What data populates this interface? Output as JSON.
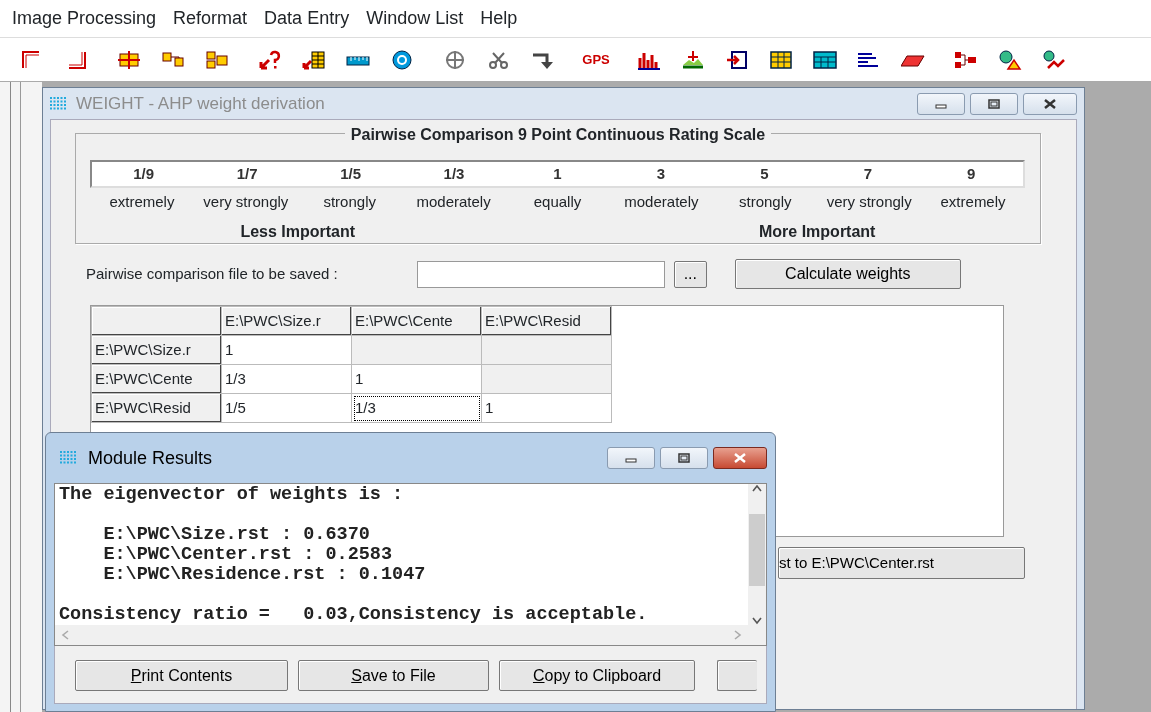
{
  "menu": [
    {
      "label": "Image Processing"
    },
    {
      "label": "Reformat"
    },
    {
      "label": "Data Entry"
    },
    {
      "label": "Window List"
    },
    {
      "label": "Help"
    }
  ],
  "toolbar": {
    "gps_label": "GPS"
  },
  "weight_window": {
    "title": "WEIGHT - AHP weight derivation",
    "active": false,
    "scale": {
      "title": "Pairwise Comparison 9 Point Continuous Rating Scale",
      "points": [
        {
          "value": "1/9",
          "label": "extremely"
        },
        {
          "value": "1/7",
          "label": "very strongly"
        },
        {
          "value": "1/5",
          "label": "strongly"
        },
        {
          "value": "1/3",
          "label": "moderately"
        },
        {
          "value": "1",
          "label": "equally"
        },
        {
          "value": "3",
          "label": "moderately"
        },
        {
          "value": "5",
          "label": "strongly"
        },
        {
          "value": "7",
          "label": "very strongly"
        },
        {
          "value": "9",
          "label": "extremely"
        }
      ],
      "less_label": "Less Important",
      "more_label": "More Important"
    },
    "file_label": "Pairwise comparison file to be saved :",
    "browse_button": "...",
    "calculate_button": "Calculate weights",
    "grid": {
      "columns": [
        "E:\\PWC\\Size.r",
        "E:\\PWC\\Cente",
        "E:\\PWC\\Resid"
      ],
      "rows": [
        {
          "header": "E:\\PWC\\Size.r",
          "cells": [
            {
              "text": "1",
              "disabled": false,
              "selected": false
            },
            {
              "disabled": true,
              "selected": false
            },
            {
              "disabled": true,
              "selected": false
            }
          ]
        },
        {
          "header": "E:\\PWC\\Cente",
          "cells": [
            {
              "text": "1/3",
              "disabled": false,
              "selected": false
            },
            {
              "text": "1",
              "disabled": false,
              "selected": false
            },
            {
              "disabled": true,
              "selected": false
            }
          ]
        },
        {
          "header": "E:\\PWC\\Resid",
          "cells": [
            {
              "text": "1/5",
              "disabled": false,
              "selected": false
            },
            {
              "text": "1/3",
              "disabled": false,
              "selected": true
            },
            {
              "text": "1",
              "disabled": false,
              "selected": false
            }
          ]
        }
      ]
    },
    "partial_button": "st to E:\\PWC\\Center.rst"
  },
  "results_window": {
    "title": "Module Results",
    "active": true,
    "paragraphs": [
      {
        "lines": [
          "The eigenvector of weights is :"
        ]
      },
      {
        "lines": [
          "    E:\\PWC\\Size.rst : 0.6370",
          "    E:\\PWC\\Center.rst : 0.2583",
          "    E:\\PWC\\Residence.rst : 0.1047"
        ]
      },
      {
        "lines": [
          "Consistency ratio =   0.03,Consistency is acceptable."
        ]
      }
    ],
    "buttons": [
      {
        "label": "Print Contents"
      },
      {
        "label": "Save to File"
      },
      {
        "label": "Copy to Clipboard"
      }
    ]
  }
}
